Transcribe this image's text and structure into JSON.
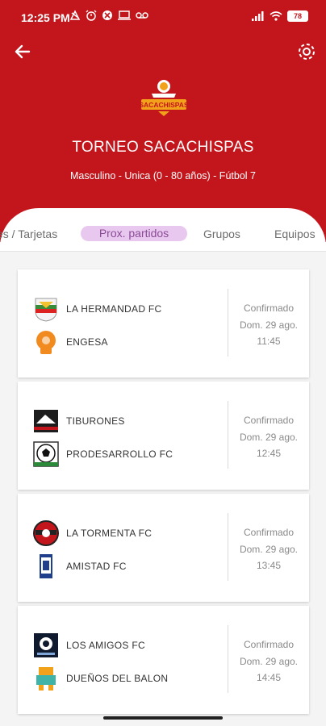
{
  "status_bar": {
    "time": "12:25 PM",
    "left_icons": [
      "data-saver-icon",
      "alarm-icon",
      "app-icon",
      "cast-icon",
      "voicemail-icon"
    ],
    "battery": "78"
  },
  "header": {
    "title": "TORNEO SACACHISPAS",
    "subtitle": "Masculino - Unica (0 - 80 años) - Fútbol 7",
    "logo_text": "SACACHISPAS",
    "color": "#c3161c"
  },
  "tabs": [
    {
      "label": "es / Tarjetas",
      "active": false
    },
    {
      "label": "Prox. partidos",
      "active": true
    },
    {
      "label": "Grupos",
      "active": false
    },
    {
      "label": "Equipos",
      "active": false
    }
  ],
  "matches": [
    {
      "home": "LA HERMANDAD FC",
      "away": "ENGESA",
      "status": "Confirmado",
      "date": "Dom. 29 ago.",
      "time": "11:45"
    },
    {
      "home": "TIBURONES",
      "away": "PRODESARROLLO FC",
      "status": "Confirmado",
      "date": "Dom. 29 ago.",
      "time": "12:45"
    },
    {
      "home": "LA TORMENTA FC",
      "away": "AMISTAD FC",
      "status": "Confirmado",
      "date": "Dom. 29 ago.",
      "time": "13:45"
    },
    {
      "home": "LOS AMIGOS FC",
      "away": "DUEÑOS DEL BALON",
      "status": "Confirmado",
      "date": "Dom. 29 ago.",
      "time": "14:45"
    }
  ]
}
